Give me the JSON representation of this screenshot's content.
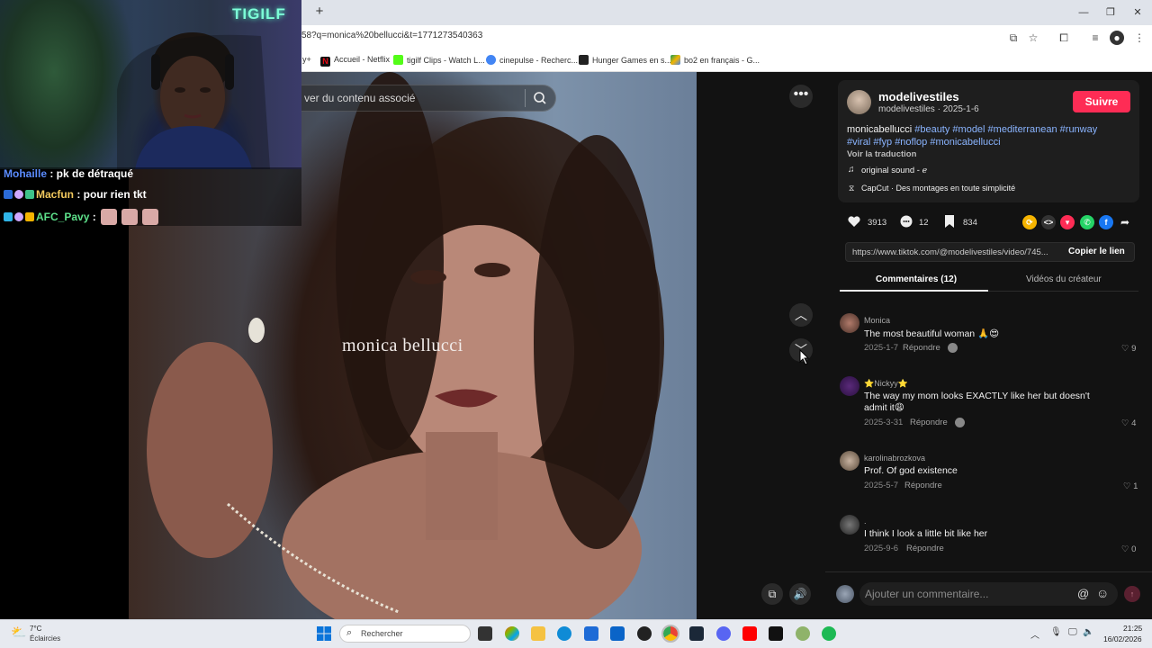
{
  "browser": {
    "url": "58?q=monica%20bellucci&t=1771273540363",
    "bookmarks": [
      "Accueil - Netflix",
      "tigilf Clips - Watch L...",
      "cinepulse - Recherc...",
      "Hunger Games en s...",
      "bo2 en français - G..."
    ],
    "bookmark_partial": "y+"
  },
  "video": {
    "search_placeholder": "ver du contenu associé",
    "overlay_caption": "monica bellucci"
  },
  "post": {
    "username": "modelivestiles",
    "subline": "modelivestiles · 2025-1-6",
    "follow_label": "Suivre",
    "caption_plain": "monicabellucci",
    "hashtags_line1": "#beauty #model #mediterranean #runway",
    "hashtags_line2": "#viral #fyp #noflop #monicabellucci",
    "translate_label": "Voir la traduction",
    "sound": "original sound - ℯ",
    "capcut": "CapCut · Des montages en toute simplicité",
    "likes": "3913",
    "comments": "12",
    "saves": "834",
    "link": "https://www.tiktok.com/@modelivestiles/video/745...",
    "copy_label": "Copier le lien"
  },
  "tabs": {
    "comments": "Commentaires (12)",
    "creator": "Vidéos du créateur"
  },
  "comments": [
    {
      "name": "Monica",
      "text": "The most beautiful woman 🙏😍",
      "date": "2025-1-7",
      "reply": "Répondre",
      "likes": "9"
    },
    {
      "name": "⭐Nickyy⭐",
      "text": "The way my mom looks EXACTLY like her but doesn't",
      "text2": "admit it😩",
      "date": "2025-3-31",
      "reply": "Répondre",
      "likes": "4"
    },
    {
      "name": "karolinabrozkova",
      "text": "Prof. Of god existence",
      "date": "2025-5-7",
      "reply": "Répondre",
      "likes": "1"
    },
    {
      "name": ".",
      "text": "I think I look a little bit like her",
      "date": "2025-9-6",
      "reply": "Répondre",
      "likes": "0"
    }
  ],
  "comment_input_placeholder": "Ajouter un commentaire...",
  "stream": {
    "neon_sign": "TIGILF",
    "chat": [
      {
        "user": "Mohaille",
        "msg": " : pk de détraqué"
      },
      {
        "user": "Macfun",
        "msg": " : pour rien tkt"
      },
      {
        "user": "AFC_Pavy",
        "msg": " :"
      }
    ]
  },
  "taskbar": {
    "weather_temp": "7°C",
    "weather_desc": "Éclaircies",
    "search_label": "Rechercher",
    "time": "21:25",
    "date": "16/02/2026"
  },
  "colors": {
    "accent": "#fe2c55",
    "hashtag": "#8ab4ff",
    "panel_bg": "#121212"
  }
}
